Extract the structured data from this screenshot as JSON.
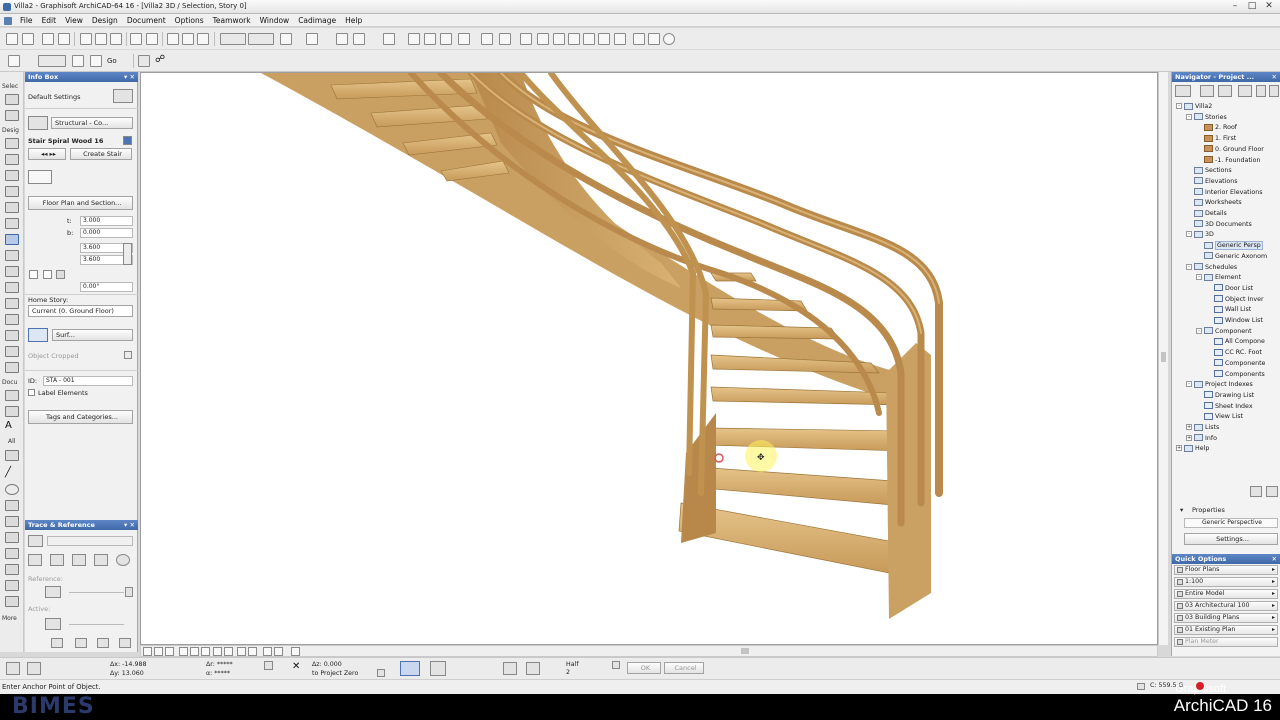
{
  "title": "Villa2 - Graphisoft ArchiCAD-64 16 - [Villa2 3D / Selection, Story 0]",
  "menu": [
    "File",
    "Edit",
    "View",
    "Design",
    "Document",
    "Options",
    "Teamwork",
    "Window",
    "Cadimage",
    "Help"
  ],
  "toolbar": {
    "go_label": "Go"
  },
  "toolbox": {
    "select_label": "Selec",
    "design_label": "Desig",
    "docu_label": "Docu",
    "all_label": "All",
    "more_label": "More"
  },
  "infobox": {
    "title": "Info Box",
    "default_settings": "Default Settings",
    "layer": "Structural - Co...",
    "object_name": "Stair Spiral Wood 16",
    "create_stair": "Create Stair",
    "floor_plan_section": "Floor Plan and Section...",
    "height_1": "3.000",
    "height_2": "0.000",
    "dim_1": "3.600",
    "dim_2": "3.600",
    "angle": "0.00°",
    "home_story_label": "Home Story:",
    "home_story_value": "Current (0. Ground Floor)",
    "surface": "Surf...",
    "object_cropped": "Object Cropped",
    "id_label": "ID:",
    "id_value": "STA - 001",
    "label_elements": "Label Elements",
    "tags_categories": "Tags and Categories..."
  },
  "trace": {
    "title": "Trace & Reference",
    "reference_label": "Reference:",
    "active_label": "Active:"
  },
  "navigator": {
    "title": "Navigator - Project ...",
    "tree": [
      {
        "label": "Villa2",
        "indent": 0,
        "icon": "project",
        "toggle": "-"
      },
      {
        "label": "Stories",
        "indent": 1,
        "icon": "folder",
        "toggle": "-"
      },
      {
        "label": "2. Roof",
        "indent": 2,
        "icon": "story",
        "toggle": ""
      },
      {
        "label": "1. First",
        "indent": 2,
        "icon": "story",
        "toggle": ""
      },
      {
        "label": "0. Ground Floor",
        "indent": 2,
        "icon": "story",
        "toggle": ""
      },
      {
        "label": "-1. Foundation",
        "indent": 2,
        "icon": "story",
        "toggle": ""
      },
      {
        "label": "Sections",
        "indent": 1,
        "icon": "folder",
        "toggle": ""
      },
      {
        "label": "Elevations",
        "indent": 1,
        "icon": "folder",
        "toggle": ""
      },
      {
        "label": "Interior Elevations",
        "indent": 1,
        "icon": "folder",
        "toggle": ""
      },
      {
        "label": "Worksheets",
        "indent": 1,
        "icon": "folder",
        "toggle": ""
      },
      {
        "label": "Details",
        "indent": 1,
        "icon": "folder",
        "toggle": ""
      },
      {
        "label": "3D Documents",
        "indent": 1,
        "icon": "folder",
        "toggle": ""
      },
      {
        "label": "3D",
        "indent": 1,
        "icon": "folder",
        "toggle": "-"
      },
      {
        "label": "Generic Persp",
        "indent": 2,
        "icon": "view",
        "toggle": "",
        "selected": true
      },
      {
        "label": "Generic Axonom",
        "indent": 2,
        "icon": "view",
        "toggle": ""
      },
      {
        "label": "Schedules",
        "indent": 1,
        "icon": "folder",
        "toggle": "-"
      },
      {
        "label": "Element",
        "indent": 2,
        "icon": "folder",
        "toggle": "-"
      },
      {
        "label": "Door List",
        "indent": 3,
        "icon": "sched",
        "toggle": ""
      },
      {
        "label": "Object Inver",
        "indent": 3,
        "icon": "sched",
        "toggle": ""
      },
      {
        "label": "Wall List",
        "indent": 3,
        "icon": "sched",
        "toggle": ""
      },
      {
        "label": "Window List",
        "indent": 3,
        "icon": "sched",
        "toggle": ""
      },
      {
        "label": "Component",
        "indent": 2,
        "icon": "folder",
        "toggle": "-"
      },
      {
        "label": "All Compone",
        "indent": 3,
        "icon": "sched",
        "toggle": ""
      },
      {
        "label": "CC RC. Foot",
        "indent": 3,
        "icon": "sched",
        "toggle": ""
      },
      {
        "label": "Componente",
        "indent": 3,
        "icon": "sched",
        "toggle": ""
      },
      {
        "label": "Components",
        "indent": 3,
        "icon": "sched",
        "toggle": ""
      },
      {
        "label": "Project Indexes",
        "indent": 1,
        "icon": "folder",
        "toggle": "-"
      },
      {
        "label": "Drawing List",
        "indent": 2,
        "icon": "sched",
        "toggle": ""
      },
      {
        "label": "Sheet Index",
        "indent": 2,
        "icon": "sched",
        "toggle": ""
      },
      {
        "label": "View List",
        "indent": 2,
        "icon": "sched",
        "toggle": ""
      },
      {
        "label": "Lists",
        "indent": 1,
        "icon": "folder",
        "toggle": "+"
      },
      {
        "label": "Info",
        "indent": 1,
        "icon": "folder",
        "toggle": "+"
      },
      {
        "label": "Help",
        "indent": 0,
        "icon": "folder",
        "toggle": "+"
      }
    ],
    "properties_label": "Properties",
    "view_name": "Generic Perspective",
    "settings_button": "Settings..."
  },
  "quick_options": {
    "title": "Quick Options",
    "items": [
      "Floor Plans",
      "1:100",
      "Entire Model",
      "03 Architectural 100",
      "03 Building Plans",
      "01 Existing Plan",
      "Plan Meter"
    ]
  },
  "coords": {
    "dx": "Δx: -14.988",
    "dy": "Δy: 13.060",
    "dr": "Δr: *****",
    "da": "α: *****",
    "dz": "Δz: 0.000",
    "to_zero": "to Project Zero",
    "half": "Half",
    "half_num": "2",
    "ok": "OK",
    "cancel": "Cancel"
  },
  "status": {
    "prompt": "Enter Anchor Point of Object.",
    "disk": "C: 559.5 G"
  },
  "brand": {
    "left": "BIMES",
    "company": "Graphisoft",
    "product": "ArchiCAD 16"
  },
  "colors": {
    "wood": "#d9b06f",
    "wood_dark": "#a67b3d",
    "panel_head": "#4a74b4",
    "viewport_bg": "#ffffff"
  }
}
